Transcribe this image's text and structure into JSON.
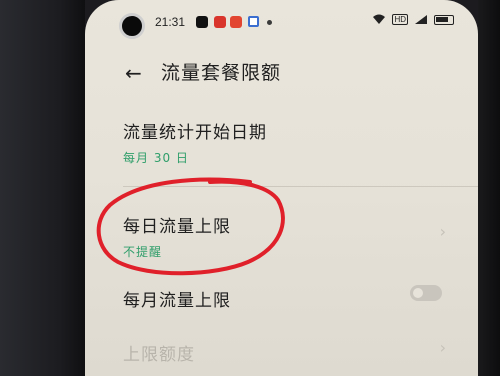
{
  "status_bar": {
    "time": "21:31",
    "network_label": "HD"
  },
  "header": {
    "back_icon": "←",
    "title": "流量套餐限额"
  },
  "items": [
    {
      "label": "流量统计开始日期",
      "sub": "每月 30 日"
    },
    {
      "label": "每日流量上限",
      "sub": "不提醒"
    },
    {
      "label": "每月流量上限"
    },
    {
      "label": "上限额度"
    }
  ],
  "colors": {
    "accent_green": "#2f9e6a",
    "annotation_red": "#e0202a"
  }
}
